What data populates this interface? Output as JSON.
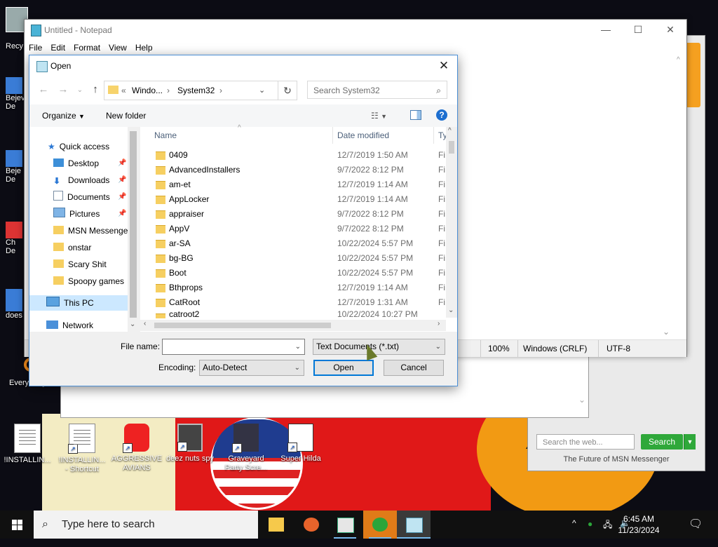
{
  "desktop": {
    "top_left_label": "Recy",
    "left_icons": [
      {
        "label": "Bejev\nDe"
      },
      {
        "label": "Beje\nDe"
      },
      {
        "label": "Ch\nDe"
      },
      {
        "label": "does"
      },
      {
        "label": "Everything"
      }
    ],
    "icons": [
      {
        "label": "!INSTALLIN..."
      },
      {
        "label": "!INSTALLIN...\n- Shortcut"
      },
      {
        "label": "AGGRESSIVE\nAVIANS"
      },
      {
        "label": "deez nuts spy"
      },
      {
        "label": "Graveyard\nParty Scre..."
      },
      {
        "label": "Super Hilda"
      }
    ]
  },
  "msn": {
    "search_placeholder": "Search the web...",
    "search_button": "Search",
    "footer": "The Future of MSN Messenger"
  },
  "notepad": {
    "title": "Untitled - Notepad",
    "menu": [
      "File",
      "Edit",
      "Format",
      "View",
      "Help"
    ],
    "status": {
      "zoom": "100%",
      "line_ending": "Windows (CRLF)",
      "encoding": "UTF-8"
    }
  },
  "dialog": {
    "title": "Open",
    "address": {
      "prefix": "«",
      "crumb1": "Windo...",
      "crumb2": "System32"
    },
    "search_placeholder": "Search System32",
    "toolbar": {
      "organize": "Organize",
      "new_folder": "New folder"
    },
    "nav": {
      "quick_access": "Quick access",
      "items": [
        {
          "label": "Desktop",
          "pinned": true
        },
        {
          "label": "Downloads",
          "pinned": true
        },
        {
          "label": "Documents",
          "pinned": true
        },
        {
          "label": "Pictures",
          "pinned": true
        },
        {
          "label": "MSN Messenger",
          "pinned": false
        },
        {
          "label": "onstar",
          "pinned": false
        },
        {
          "label": "Scary Shit",
          "pinned": false
        },
        {
          "label": "Spoopy games",
          "pinned": false
        }
      ],
      "this_pc": "This PC",
      "network": "Network"
    },
    "columns": {
      "name": "Name",
      "date": "Date modified",
      "type": "Ty"
    },
    "files": [
      {
        "name": "0409",
        "date": "12/7/2019 1:50 AM",
        "type": "Fi"
      },
      {
        "name": "AdvancedInstallers",
        "date": "9/7/2022 8:12 PM",
        "type": "Fi"
      },
      {
        "name": "am-et",
        "date": "12/7/2019 1:14 AM",
        "type": "Fi"
      },
      {
        "name": "AppLocker",
        "date": "12/7/2019 1:14 AM",
        "type": "Fi"
      },
      {
        "name": "appraiser",
        "date": "9/7/2022 8:12 PM",
        "type": "Fi"
      },
      {
        "name": "AppV",
        "date": "9/7/2022 8:12 PM",
        "type": "Fi"
      },
      {
        "name": "ar-SA",
        "date": "10/22/2024 5:57 PM",
        "type": "Fi"
      },
      {
        "name": "bg-BG",
        "date": "10/22/2024 5:57 PM",
        "type": "Fi"
      },
      {
        "name": "Boot",
        "date": "10/22/2024 5:57 PM",
        "type": "Fi"
      },
      {
        "name": "Bthprops",
        "date": "12/7/2019 1:14 AM",
        "type": "Fi"
      },
      {
        "name": "CatRoot",
        "date": "12/7/2019 1:31 AM",
        "type": "Fi"
      },
      {
        "name": "catroot2",
        "date": "10/22/2024 10:27 PM",
        "type": "Fi"
      }
    ],
    "file_name_label": "File name:",
    "file_name_value": "",
    "file_type": "Text Documents (*.txt)",
    "encoding_label": "Encoding:",
    "encoding_value": "Auto-Detect",
    "open_button": "Open",
    "cancel_button": "Cancel"
  },
  "taskbar": {
    "search_text": "Type here to search",
    "time": "6:45 AM",
    "date": "11/23/2024"
  }
}
